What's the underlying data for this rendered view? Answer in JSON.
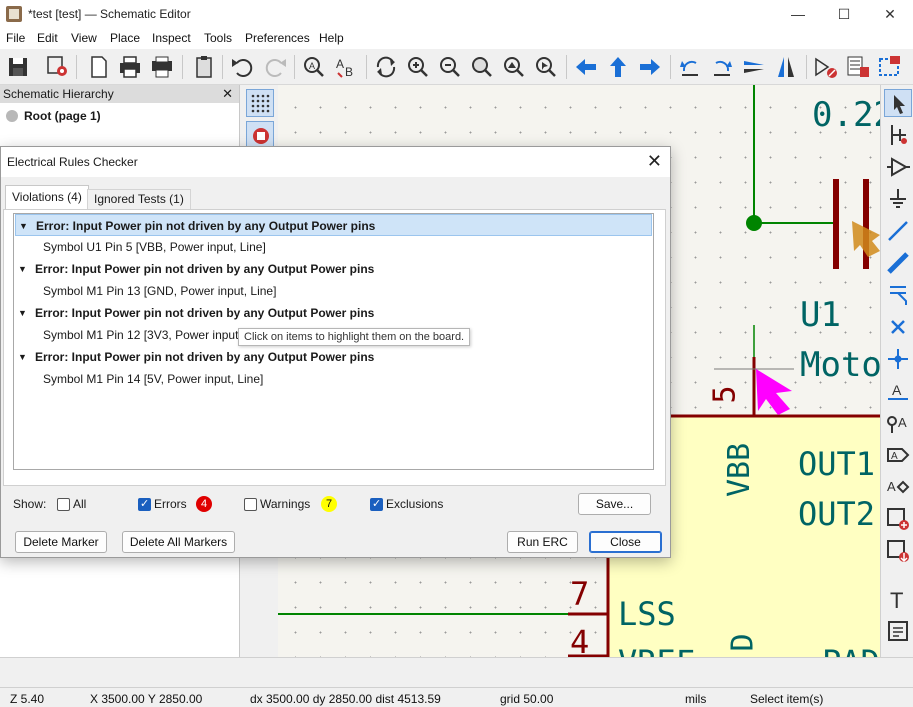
{
  "window": {
    "title": "*test [test] — Schematic Editor",
    "minimize": "—",
    "maximize": "☐",
    "close": "✕"
  },
  "menu": [
    "File",
    "Edit",
    "View",
    "Place",
    "Inspect",
    "Tools",
    "Preferences",
    "Help"
  ],
  "hierarchy": {
    "header": "Schematic Hierarchy",
    "close": "✕",
    "root": "Root (page 1)"
  },
  "canvas": {
    "texts": {
      "value_partial": "0.22",
      "ref": "U1",
      "name_partial": "Moto",
      "pin5": "5",
      "vbb": "VBB",
      "out1": "OUT1",
      "out2": "OUT2",
      "pin7": "7",
      "pin4": "4",
      "lss": "LSS",
      "vref": "VREF",
      "d_label": "D",
      "pad": "PAD",
      "cut_digit": "2"
    },
    "colors": {
      "wire": "#008400",
      "component": "#840000",
      "body_fill": "#ffffc2",
      "text": "#006464",
      "marker": "#ff00ff"
    }
  },
  "dialog": {
    "title": "Electrical Rules Checker",
    "close": "✕",
    "tabs": [
      {
        "label": "Violations (4)",
        "active": true
      },
      {
        "label": "Ignored Tests (1)",
        "active": false
      }
    ],
    "violations": [
      {
        "title": "Error: Input Power pin not driven by any Output Power pins",
        "item": "Symbol U1 Pin 5 [VBB, Power input, Line]"
      },
      {
        "title": "Error: Input Power pin not driven by any Output Power pins",
        "item": "Symbol M1 Pin 13 [GND, Power input, Line]"
      },
      {
        "title": "Error: Input Power pin not driven by any Output Power pins",
        "item": "Symbol M1 Pin 12 [3V3, Power input, Line]"
      },
      {
        "title": "Error: Input Power pin not driven by any Output Power pins",
        "item": "Symbol M1 Pin 14 [5V, Power input, Line]"
      }
    ],
    "tooltip": "Click on items to highlight them on the board.",
    "show_label": "Show:",
    "filters": [
      {
        "label": "All",
        "checked": false
      },
      {
        "label": "Errors",
        "checked": true,
        "count": "4",
        "badge_color": "#e00000"
      },
      {
        "label": "Warnings",
        "checked": false,
        "count": "7",
        "badge_color": "#ffff00"
      },
      {
        "label": "Exclusions",
        "checked": true
      }
    ],
    "buttons": {
      "save": "Save...",
      "delete_marker": "Delete Marker",
      "delete_all": "Delete All Markers",
      "run_erc": "Run ERC",
      "close": "Close"
    }
  },
  "status": {
    "zoom": "Z 5.40",
    "xy": "X 3500.00  Y 2850.00",
    "delta": "dx 3500.00  dy 2850.00  dist 4513.59",
    "grid": "grid 50.00",
    "units": "mils",
    "mode": "Select item(s)"
  }
}
